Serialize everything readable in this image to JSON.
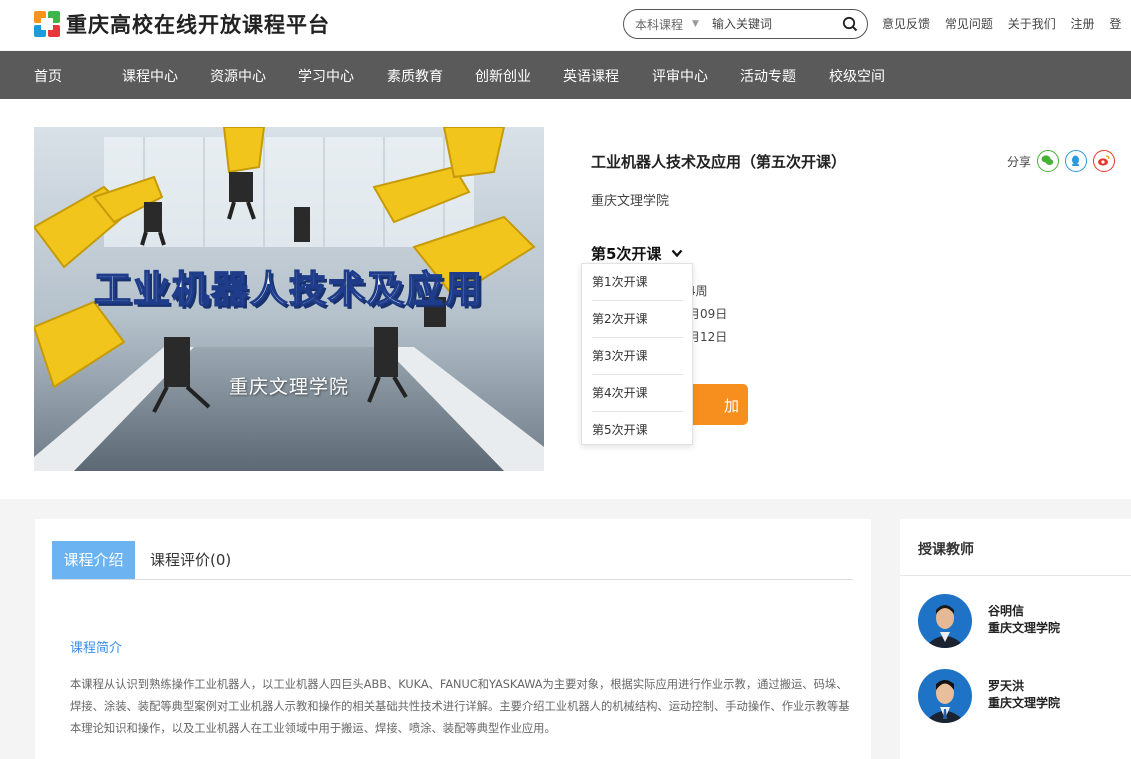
{
  "brand": {
    "title": "重庆高校在线开放课程平台",
    "colors": {
      "orange": "#f7941d",
      "green": "#3db54a",
      "blue": "#1d9bd7",
      "red": "#e8383d"
    }
  },
  "search": {
    "category": "本科课程",
    "placeholder": "输入关键词"
  },
  "top_links": [
    "意见反馈",
    "常见问题",
    "关于我们",
    "注册",
    "登"
  ],
  "nav": [
    "首页",
    "课程中心",
    "资源中心",
    "学习中心",
    "素质教育",
    "创新创业",
    "英语课程",
    "评审中心",
    "活动专题",
    "校级空间"
  ],
  "course": {
    "cover_title": "工业机器人技术及应用",
    "cover_school": "重庆文理学院",
    "title": "工业机器人技术及应用（第五次开课）",
    "school": "重庆文理学院",
    "share_label": "分享",
    "share_icons": [
      "wechat-icon",
      "qq-icon",
      "weibo-icon"
    ],
    "session_label": "第5次开课",
    "info_fragments": [
      "4周",
      "月09日",
      "月12日"
    ],
    "enroll_fragment": "加",
    "sessions": [
      "第1次开课",
      "第2次开课",
      "第3次开课",
      "第4次开课",
      "第5次开课"
    ]
  },
  "tabs": {
    "active": "课程介绍",
    "other": "课程评价(0)"
  },
  "intro": {
    "heading": "课程简介",
    "text": "本课程从认识到熟练操作工业机器人，以工业机器人四巨头ABB、KUKA、FANUC和YASKAWA为主要对象，根据实际应用进行作业示教，通过搬运、码垛、焊接、涂装、装配等典型案例对工业机器人示教和操作的相关基础共性技术进行详解。主要介绍工业机器人的机械结构、运动控制、手动操作、作业示教等基本理论知识和操作，以及工业机器人在工业领域中用于搬运、焊接、喷涂、装配等典型作业应用。"
  },
  "teachers": {
    "heading": "授课教师",
    "list": [
      {
        "name": "谷明信",
        "school": "重庆文理学院"
      },
      {
        "name": "罗天洪",
        "school": "重庆文理学院"
      }
    ]
  }
}
